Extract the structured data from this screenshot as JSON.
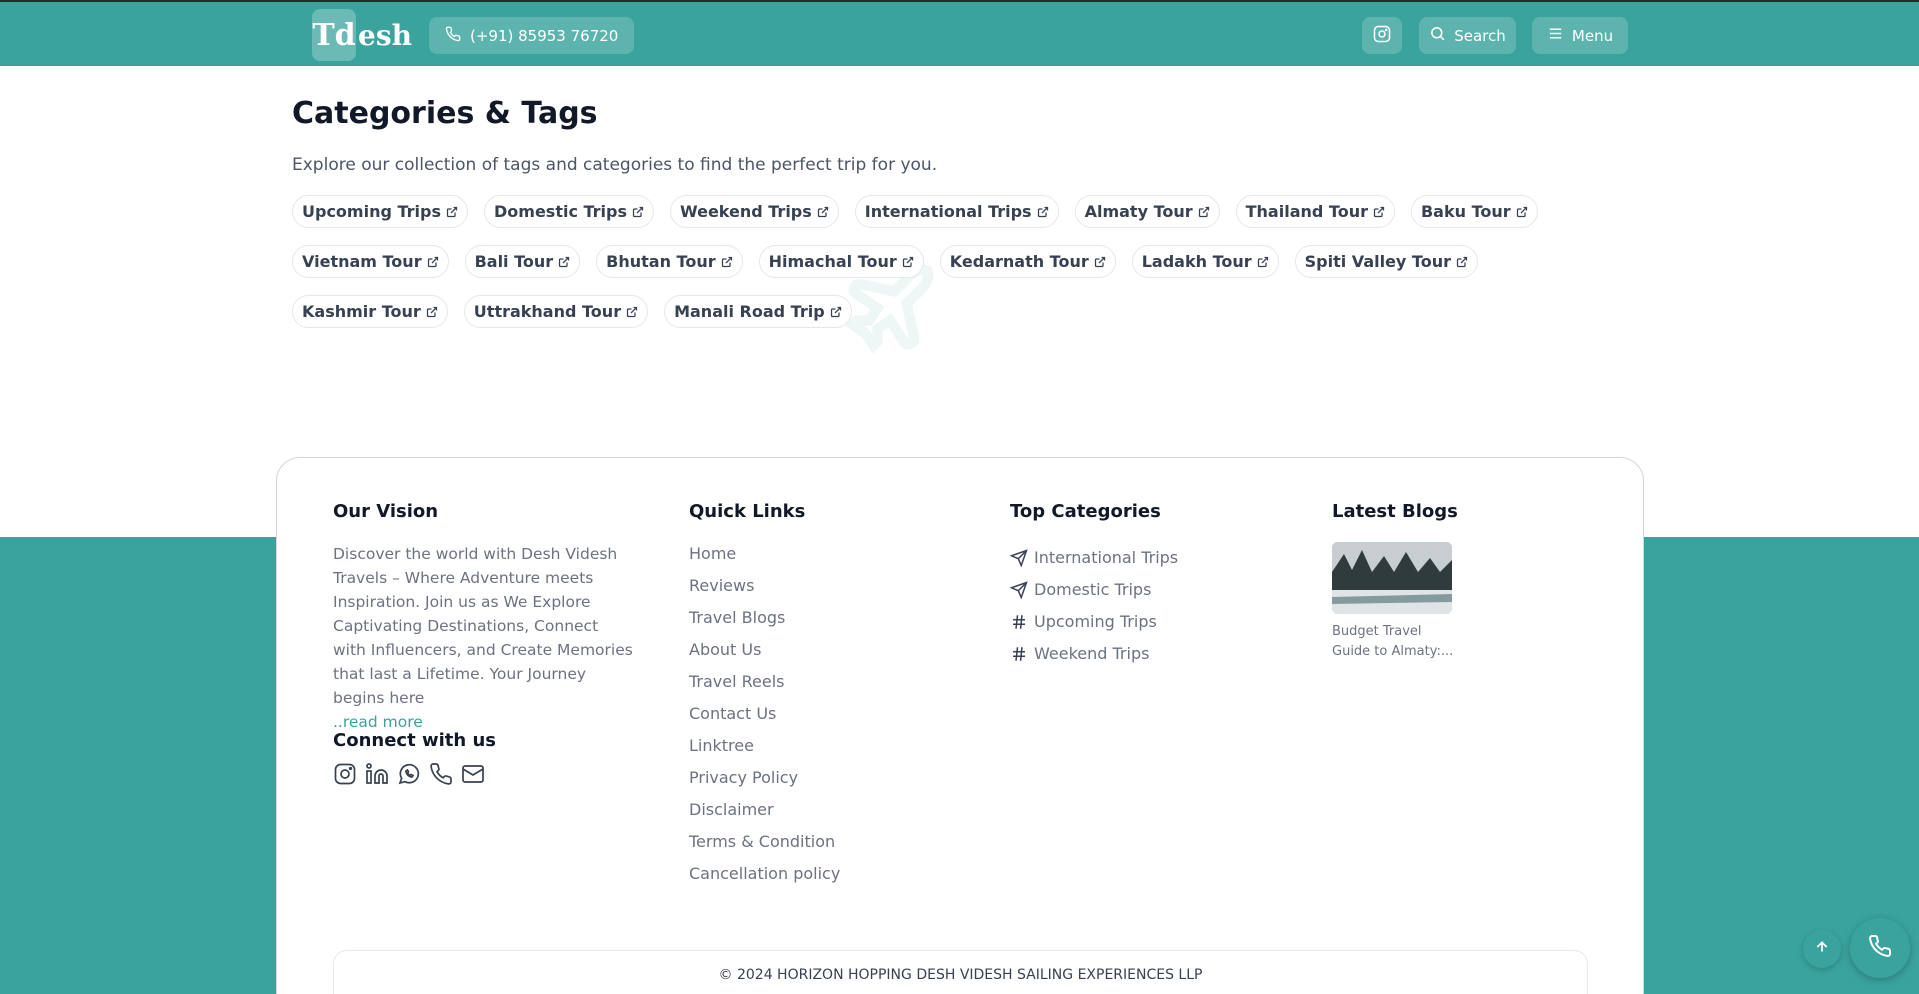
{
  "header": {
    "logo_mark": "Td",
    "logo_text": "esh",
    "phone": "(+91) 85953 76720",
    "search_label": "Search",
    "menu_label": "Menu"
  },
  "categories": {
    "title": "Categories & Tags",
    "description": "Explore our collection of tags and categories to find the perfect trip for you.",
    "tags": [
      "Upcoming Trips",
      "Domestic Trips",
      "Weekend Trips",
      "International Trips",
      "Almaty Tour",
      "Thailand Tour",
      "Baku Tour",
      "Vietnam Tour",
      "Bali Tour",
      "Bhutan Tour",
      "Himachal Tour",
      "Kedarnath Tour",
      "Ladakh Tour",
      "Spiti Valley Tour",
      "Kashmir Tour",
      "Uttrakhand Tour",
      "Manali Road Trip"
    ]
  },
  "footer": {
    "vision_title": "Our Vision",
    "vision_text": "Discover the world with Desh Videsh Travels – Where Adventure meets Inspiration. Join us as We Explore Captivating Destinations, Connect with Influencers, and Create Memories that last a Lifetime. Your Journey begins here",
    "read_more": "..read more",
    "connect_title": "Connect with us",
    "social_icons": [
      "instagram-icon",
      "linkedin-icon",
      "whatsapp-icon",
      "phone-icon",
      "mail-icon"
    ],
    "quick_links_title": "Quick Links",
    "quick_links": [
      "Home",
      "Reviews",
      "Travel Blogs",
      "About Us",
      "Travel Reels",
      "Contact Us",
      "Linktree",
      "Privacy Policy",
      "Disclaimer",
      "Terms & Condition",
      "Cancellation policy"
    ],
    "top_categories_title": "Top Categories",
    "top_categories": [
      {
        "label": "International Trips",
        "icon": "send-icon"
      },
      {
        "label": "Domestic Trips",
        "icon": "send-icon"
      },
      {
        "label": "Upcoming Trips",
        "icon": "hash-icon"
      },
      {
        "label": "Weekend Trips",
        "icon": "hash-icon"
      }
    ],
    "latest_blogs_title": "Latest Blogs",
    "blog_title": "Budget Travel Guide to Almaty:...",
    "copyright": "© 2024 HORIZON HOPPING DESH VIDESH SAILING EXPERIENCES LLP"
  },
  "colors": {
    "brand": "#3aa39d"
  }
}
